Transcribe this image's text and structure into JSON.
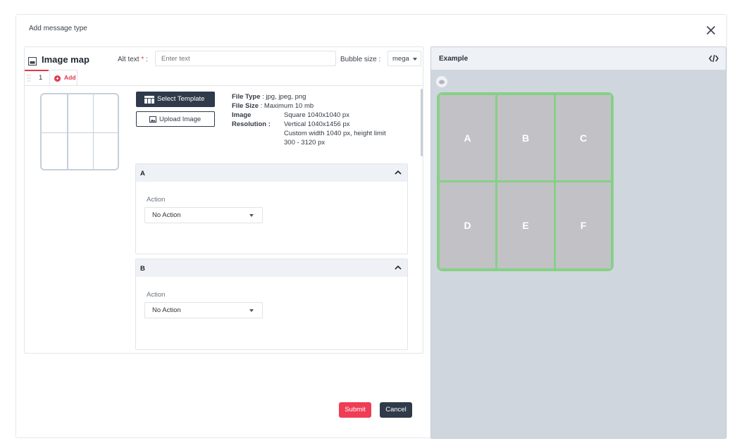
{
  "modal": {
    "title": "Add message type"
  },
  "editor": {
    "title": "Image map",
    "alt_text_label": "Alt text",
    "required_mark": "*",
    "alt_text_separator": ":",
    "alt_text_placeholder": "Enter text",
    "bubble_size_label": "Bubble size :",
    "bubble_size_value": "mega",
    "tabs": [
      {
        "label": "1"
      },
      {
        "label": "Add"
      }
    ],
    "select_template_label": "Select Template",
    "upload_image_label": "Upload Image",
    "file_info": {
      "file_type_key": "File Type",
      "file_type_value": ": jpg, jpeg, png",
      "file_size_key": "File Size",
      "file_size_value": ": Maximum 10 mb",
      "image_key": "Image",
      "resolution_key": "Resolution :",
      "resolution_lines": [
        "Square 1040x1040 px",
        "Vertical 1040x1456 px",
        "Custom width 1040 px, height limit",
        "300 - 3120 px"
      ]
    },
    "sections": [
      {
        "title": "A",
        "action_label": "Action",
        "action_value": "No Action"
      },
      {
        "title": "B",
        "action_label": "Action",
        "action_value": "No Action"
      }
    ],
    "submit_label": "Submit",
    "cancel_label": "Cancel"
  },
  "example": {
    "title": "Example",
    "code_icon": "code-icon",
    "cells": [
      "A",
      "B",
      "C",
      "D",
      "E",
      "F"
    ]
  },
  "colors": {
    "accent": "#ee3d55",
    "dark": "#2f3a4a",
    "highlight_border": "#86d086"
  }
}
